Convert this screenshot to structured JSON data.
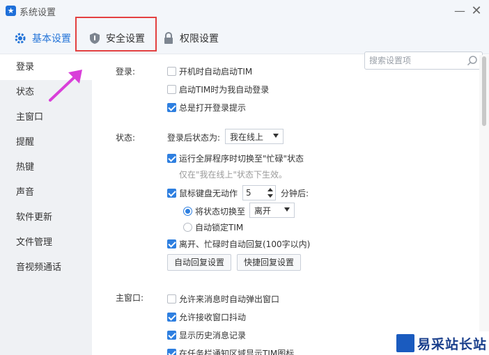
{
  "window": {
    "title": "系统设置",
    "minimize_icon": "minimize-icon",
    "close_icon": "close-icon"
  },
  "tabs": [
    {
      "label": "基本设置",
      "icon": "gear-icon",
      "active": true
    },
    {
      "label": "安全设置",
      "icon": "shield-icon",
      "active": false
    },
    {
      "label": "权限设置",
      "icon": "lock-icon",
      "active": false
    }
  ],
  "search": {
    "placeholder": "搜索设置项",
    "value": ""
  },
  "sidebar": {
    "items": [
      {
        "label": "登录",
        "active": true
      },
      {
        "label": "状态"
      },
      {
        "label": "主窗口"
      },
      {
        "label": "提醒"
      },
      {
        "label": "热键"
      },
      {
        "label": "声音"
      },
      {
        "label": "软件更新"
      },
      {
        "label": "文件管理"
      },
      {
        "label": "音视频通话"
      }
    ]
  },
  "login": {
    "title": "登录:",
    "options": [
      {
        "label": "开机时自动启动TIM",
        "checked": false
      },
      {
        "label": "启动TIM时为我自动登录",
        "checked": false
      },
      {
        "label": "总是打开登录提示",
        "checked": true
      }
    ]
  },
  "status": {
    "title": "状态:",
    "after_login_label": "登录后状态为:",
    "after_login_value": "我在线上",
    "fullscreen_label": "运行全屏程序时切换至\"忙碌\"状态",
    "fullscreen_checked": true,
    "fullscreen_hint": "仅在\"我在线上\"状态下生效。",
    "idle_label": "鼠标键盘无动作",
    "idle_checked": true,
    "idle_minutes": "5",
    "idle_suffix": "分钟后:",
    "switch_to_label": "将状态切换至",
    "switch_to_value": "离开",
    "switch_to_selected": true,
    "auto_lock_label": "自动锁定TIM",
    "auto_lock_selected": false,
    "auto_reply_label": "离开、忙碌时自动回复(100字以内)",
    "auto_reply_checked": true,
    "auto_reply_button": "自动回复设置",
    "quick_reply_button": "快捷回复设置"
  },
  "main_window": {
    "title": "主窗口:",
    "options": [
      {
        "label": "允许来消息时自动弹出窗口",
        "checked": false
      },
      {
        "label": "允许接收窗口抖动",
        "checked": true
      },
      {
        "label": "显示历史消息记录",
        "checked": true
      },
      {
        "label": "在任务栏通知区域显示TIM图标",
        "checked": true
      }
    ]
  },
  "watermark": {
    "text": "易采站长站"
  },
  "colors": {
    "accent": "#2474d8",
    "highlight_box": "#e34040",
    "arrow": "#d93fd9",
    "sidebar_bg": "#eff1f4"
  }
}
